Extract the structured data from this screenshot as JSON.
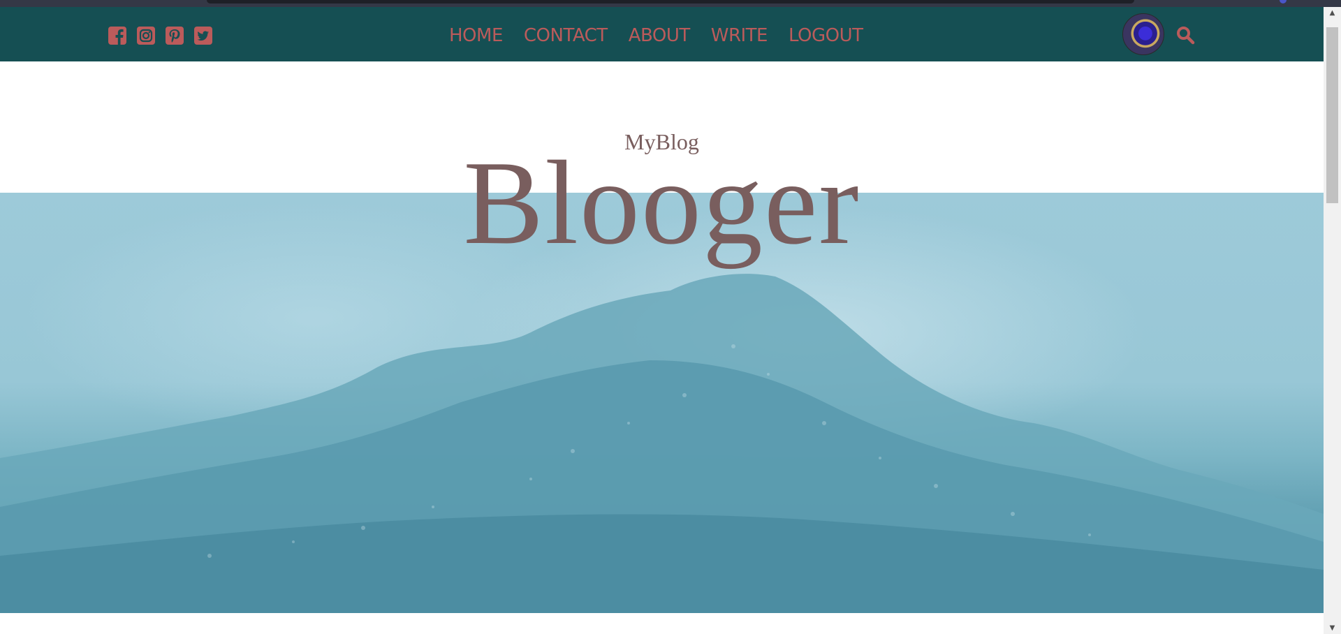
{
  "navbar": {
    "social_icons": [
      "facebook-square-icon",
      "instagram-square-icon",
      "pinterest-square-icon",
      "twitter-square-icon"
    ],
    "links": [
      "HOME",
      "CONTACT",
      "ABOUT",
      "WRITE",
      "LOGOUT"
    ],
    "search_icon": "search-icon",
    "colors": {
      "background": "#154f53",
      "link": "#bb5b5b"
    }
  },
  "header": {
    "subtitle": "MyBlog",
    "title": "Blooger",
    "text_color": "#795e5e"
  },
  "hero": {
    "image": "snowy-forest-fog"
  }
}
